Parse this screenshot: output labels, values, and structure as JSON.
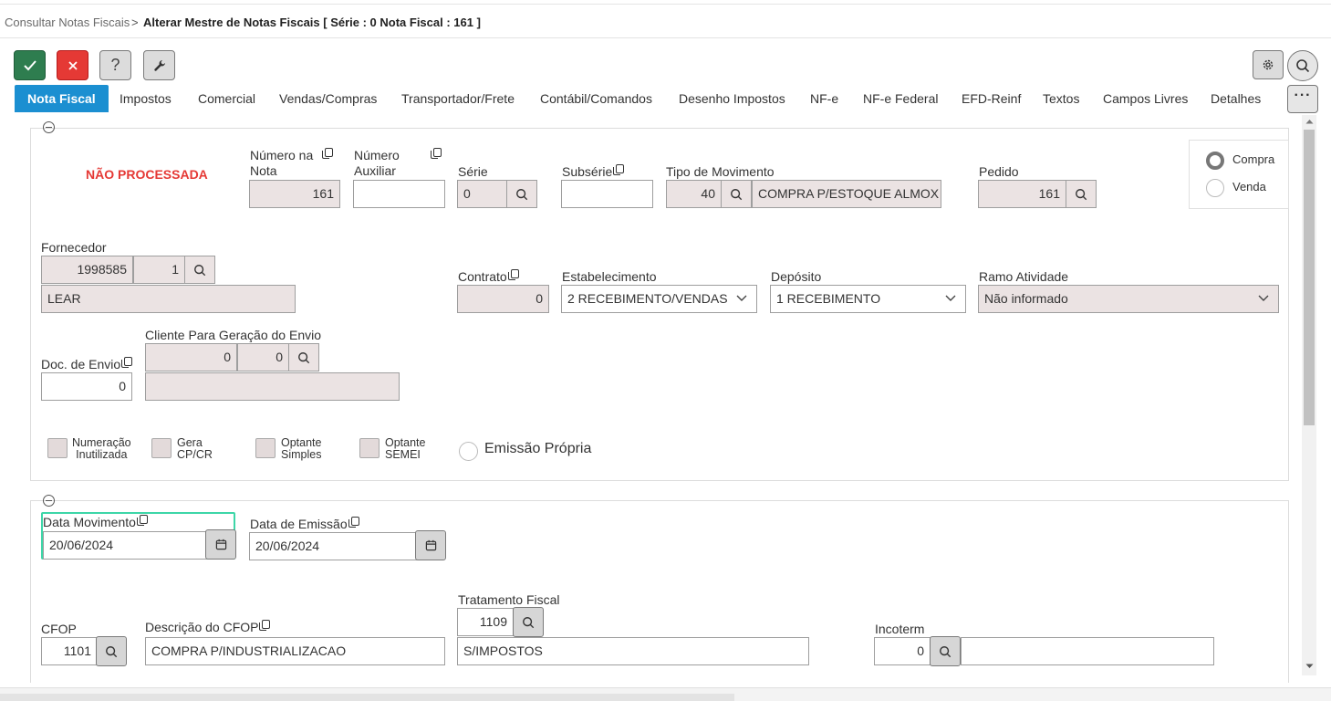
{
  "breadcrumb": {
    "parent": "Consultar Notas Fiscais",
    "separator": ">",
    "current": "Alterar Mestre de Notas Fiscais [ Série : 0 Nota Fiscal : 161 ]"
  },
  "toolbar": {
    "confirm": "check-icon",
    "cancel": "close-icon",
    "help_label": "?",
    "tools": "wrench-icon",
    "settings": "gear-icon",
    "search": "search-icon"
  },
  "tabs": [
    {
      "label": "Nota Fiscal",
      "active": true
    },
    {
      "label": "Impostos"
    },
    {
      "label": "Comercial"
    },
    {
      "label": "Vendas/Compras"
    },
    {
      "label": "Transportador/Frete"
    },
    {
      "label": "Contábil/Comandos"
    },
    {
      "label": "Desenho Impostos"
    },
    {
      "label": "NF-e"
    },
    {
      "label": "NF-e Federal"
    },
    {
      "label": "EFD-Reinf"
    },
    {
      "label": "Textos"
    },
    {
      "label": "Campos Livres"
    },
    {
      "label": "Detalhes"
    }
  ],
  "tab_more_label": "···",
  "section1": {
    "status": "NÃO PROCESSADA",
    "numero_nota": {
      "label_line1": "Número na",
      "label_line2": "Nota",
      "value": "161"
    },
    "numero_auxiliar": {
      "label_line1": "Número",
      "label_line2": "Auxiliar",
      "value": ""
    },
    "serie": {
      "label": "Série",
      "value": "0"
    },
    "subserie": {
      "label": "Subsérie",
      "value": ""
    },
    "tipo_movimento": {
      "label": "Tipo de Movimento",
      "code": "40",
      "description": "COMPRA P/ESTOQUE ALMOX"
    },
    "pedido": {
      "label": "Pedido",
      "value": "161"
    },
    "operacao": {
      "options": [
        "Compra",
        "Venda"
      ],
      "selected": "Compra"
    },
    "fornecedor": {
      "label": "Fornecedor",
      "code": "1998585",
      "seq": "1",
      "name": "LEAR"
    },
    "contrato": {
      "label": "Contrato",
      "value": "0"
    },
    "estabelecimento": {
      "label": "Estabelecimento",
      "value": "2 RECEBIMENTO/VENDAS"
    },
    "deposito": {
      "label": "Depósito",
      "value": "1 RECEBIMENTO"
    },
    "ramo_atividade": {
      "label": "Ramo Atividade",
      "value": "Não informado"
    },
    "cliente_envio": {
      "label": "Cliente Para Geração do Envio",
      "code": "0",
      "seq": "0",
      "name": ""
    },
    "doc_envio": {
      "label": "Doc. de Envio",
      "value": "0"
    },
    "checkboxes": [
      {
        "line1": "Numeração",
        "line2": "Inutilizada"
      },
      {
        "line1": "Gera",
        "line2": "CP/CR"
      },
      {
        "line1": "Optante",
        "line2": "Simples"
      },
      {
        "line1": "Optante",
        "line2": "SEMEI"
      }
    ],
    "emissao_propria": "Emissão Própria"
  },
  "section2": {
    "data_movimento": {
      "label": "Data Movimento",
      "value": "20/06/2024"
    },
    "data_emissao": {
      "label": "Data de Emissão",
      "value": "20/06/2024"
    },
    "cfop": {
      "label": "CFOP",
      "value": "1101"
    },
    "descricao_cfop": {
      "label": "Descrição do CFOP",
      "value": "COMPRA P/INDUSTRIALIZACAO"
    },
    "tratamento_fiscal": {
      "label": "Tratamento Fiscal",
      "code": "1109",
      "description": "S/IMPOSTOS"
    },
    "incoterm": {
      "label": "Incoterm",
      "code": "0",
      "description": ""
    }
  },
  "colors": {
    "accent": "#1b8fd1",
    "confirm": "#2e7d4f",
    "cancel": "#e53935",
    "status": "#e53935",
    "focus_border": "#3dd6a8",
    "readonly_field": "#ebe3e3"
  }
}
